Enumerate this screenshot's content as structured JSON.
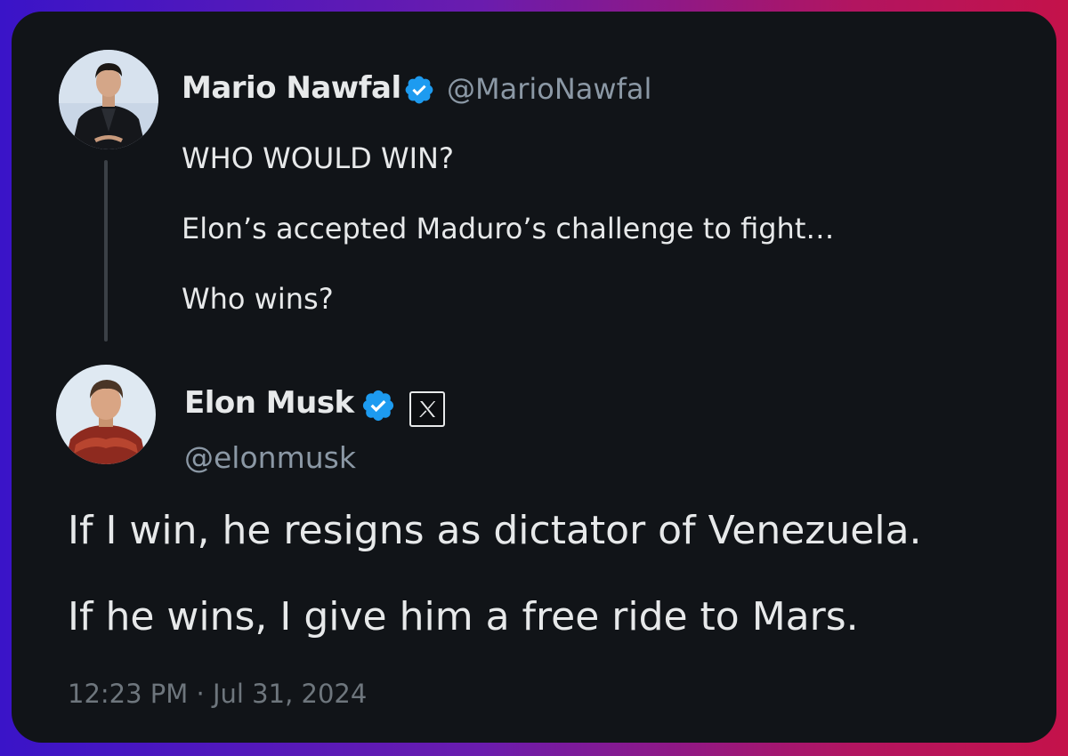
{
  "quoted_tweet": {
    "author_name": "Mario Nawfal",
    "handle": "@MarioNawfal",
    "verified": true,
    "avatar_icon": "profile-photo-man-black-suit",
    "lines": [
      "WHO WOULD WIN?",
      "Elon’s accepted Maduro’s challenge to fight…",
      "Who wins?"
    ]
  },
  "reply_tweet": {
    "author_name": "Elon Musk",
    "handle": "@elonmusk",
    "verified": true,
    "affiliate_badge_icon": "x-logo-icon",
    "avatar_icon": "profile-photo-man-red-armor",
    "lines": [
      "If I win, he resigns as dictator of Venezuela.",
      "If he wins, I give him a free ride to Mars."
    ],
    "timestamp": "12:23 PM · Jul 31, 2024"
  },
  "colors": {
    "card_background": "#111418",
    "primary_text": "#e7e9ea",
    "secondary_text": "#8b98a5",
    "verified_blue": "#1d9bf0",
    "frame_gradient_left": "#3a14c8",
    "frame_gradient_right": "#c4124a"
  }
}
